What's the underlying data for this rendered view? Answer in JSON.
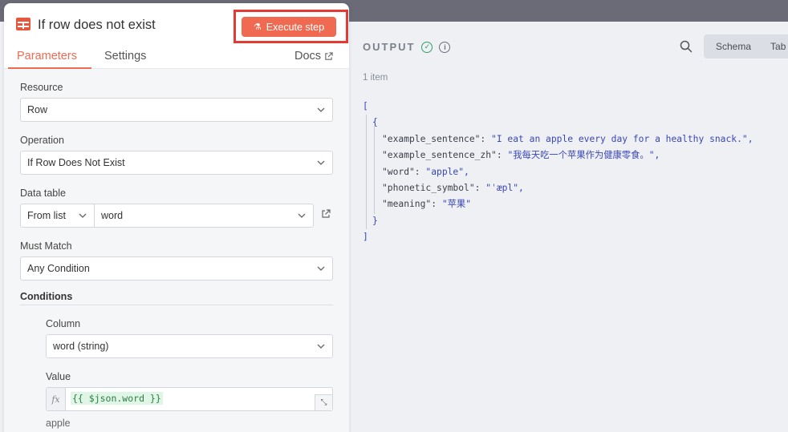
{
  "node": {
    "title": "If row does not exist",
    "execute_label": "Execute step",
    "tabs": {
      "parameters": "Parameters",
      "settings": "Settings",
      "docs": "Docs"
    }
  },
  "params": {
    "resource": {
      "label": "Resource",
      "value": "Row"
    },
    "operation": {
      "label": "Operation",
      "value": "If Row Does Not Exist"
    },
    "data_table": {
      "label": "Data table",
      "mode": "From list",
      "value": "word"
    },
    "must_match": {
      "label": "Must Match",
      "value": "Any Condition"
    },
    "conditions": {
      "title": "Conditions",
      "column": {
        "label": "Column",
        "value": "word (string)"
      },
      "value": {
        "label": "Value",
        "fx": "fx",
        "expression": "{{ $json.word }}",
        "result": "apple"
      }
    }
  },
  "output": {
    "title": "OUTPUT",
    "item_count": "1 item",
    "view_tabs": {
      "schema": "Schema",
      "table": "Tab"
    },
    "json": {
      "open_bracket": "[",
      "open_brace": "{",
      "rows": [
        {
          "key": "\"example_sentence\": ",
          "value": "\"I eat an apple every day for a healthy snack.\"",
          "suffix": ","
        },
        {
          "key": "\"example_sentence_zh\": ",
          "value": "\"我每天吃一个苹果作为健康零食。\"",
          "suffix": ","
        },
        {
          "key": "\"word\": ",
          "value": "\"apple\"",
          "suffix": ","
        },
        {
          "key": "\"phonetic_symbol\": ",
          "value": "\"ˈæpl\"",
          "suffix": ","
        },
        {
          "key": "\"meaning\": ",
          "value": "\"苹果\"",
          "suffix": ""
        }
      ],
      "close_brace": "}",
      "close_bracket": "]"
    }
  },
  "colors": {
    "accent": "#ef6b53",
    "success": "#2e9f6a",
    "json_string": "#3a47b4",
    "highlight": "#e53935"
  },
  "icons": [
    "table-icon",
    "flask-icon",
    "external-link-icon",
    "chevron-down-icon",
    "open-link-icon",
    "check-circle-icon",
    "info-icon",
    "search-icon",
    "expand-icon"
  ]
}
